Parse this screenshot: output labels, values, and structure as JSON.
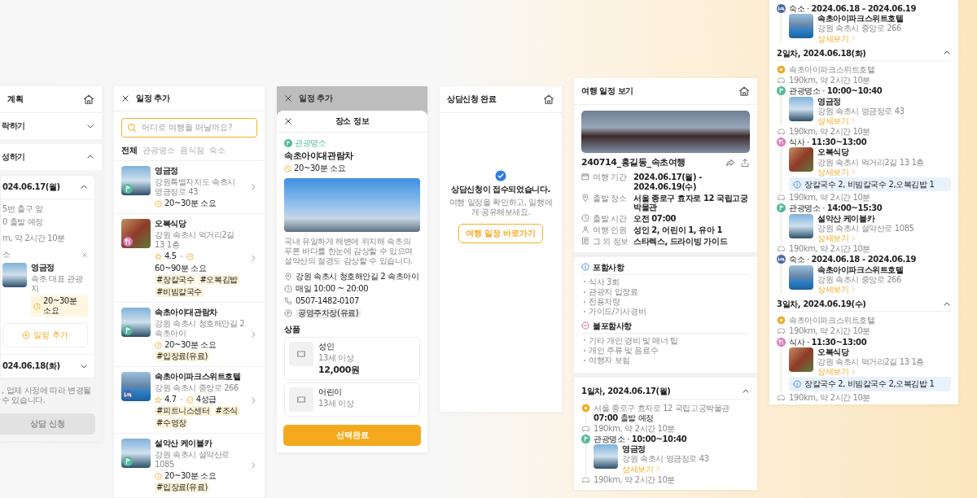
{
  "plan_screen": {
    "title": "계획",
    "sections": [
      {
        "label": "락하기",
        "expanded": false
      },
      {
        "label": "성하기",
        "expanded": true
      }
    ],
    "days": [
      {
        "label": "024.06.17(월)",
        "expanded": true,
        "start_lines": [
          "5번 출구 앞",
          "0 출발 예정"
        ],
        "drive": "m, 약 2시간 10분",
        "slot_label": "소",
        "place": {
          "name": "영금정",
          "description": "속초 대표 관광지",
          "duration": "20~30분 소요"
        },
        "add_label": "일정 추가"
      },
      {
        "label": "024.06.18(화)",
        "expanded": false
      }
    ],
    "note": ", 업체 사정에 따라 변경될 수 있습니다.",
    "submit": {
      "label": "상담 신청",
      "disabled": true
    }
  },
  "add_screen": {
    "title": "일정 추가",
    "search": {
      "placeholder": "어디로 여행을 떠날까요?"
    },
    "tabs": [
      {
        "label": "전체",
        "selected": true
      },
      {
        "label": "관광명소",
        "selected": false
      },
      {
        "label": "음식점",
        "selected": false
      },
      {
        "label": "숙소",
        "selected": false
      }
    ],
    "places": [
      {
        "kind": "attraction",
        "name": "영금정",
        "address": "강원특별자치도 속초시 영금정로 43",
        "meta": [
          {
            "kind": "time",
            "text": "20~30분 소요"
          }
        ]
      },
      {
        "kind": "food",
        "name": "오복식당",
        "address": "강원 속초시 먹거리2길 13 1층",
        "meta": [
          {
            "kind": "rating",
            "text": "4.5"
          },
          {
            "kind": "time",
            "text": "60~90분 소요"
          }
        ],
        "tags": [
          "#장칼국수",
          "#오복김밥",
          "#비빔칼국수"
        ]
      },
      {
        "kind": "attraction",
        "name": "속초아이대관람차",
        "address": "강원 속초시 청호해안길 2 속초아이",
        "meta": [
          {
            "kind": "time",
            "text": "20~30분 소요"
          }
        ],
        "tags": [
          "#입장료(유료)"
        ]
      },
      {
        "kind": "hotel",
        "name": "속초아이파크스위트호텔",
        "address": "강원 속초시 중앙로 266",
        "meta": [
          {
            "kind": "rating",
            "text": "4.7"
          },
          {
            "kind": "grade",
            "text": "4성급"
          }
        ],
        "tags": [
          "#피트니스센터",
          "#조식",
          "#수영장"
        ]
      },
      {
        "kind": "attraction",
        "name": "설악산 케이블카",
        "address": "강원 속초시 설악산로 1085",
        "meta": [
          {
            "kind": "time",
            "text": "20~30분 소요"
          }
        ],
        "tags": [
          "#입장료(유료)"
        ]
      }
    ]
  },
  "place_sheet": {
    "backdrop_title": "일정 추가",
    "title": "장소 정보",
    "category": {
      "kind": "attraction",
      "label": "관광명소"
    },
    "name": "속초아이대관람차",
    "duration": "20~30분 소요",
    "description": "국내 유일하게 해변에 위치해 속초의 푸른 바다를 한눈에 감상할 수 있으며 설악산의 절경도 감상할 수 있습니다.",
    "info": [
      {
        "kind": "address",
        "text": "강원 속초시 청호해안길 2 속초아이"
      },
      {
        "kind": "hours",
        "text": "매일 10:00 ~ 20:00"
      },
      {
        "kind": "phone",
        "text": "0507-1482-0107"
      },
      {
        "kind": "parking",
        "text": "공영주차장(유료)"
      }
    ],
    "products_title": "상품",
    "products": [
      {
        "name": "성인",
        "age": "13세 이상",
        "price": "12,000원"
      },
      {
        "name": "어린이",
        "age": "13세 이상"
      }
    ],
    "submit": "선택완료"
  },
  "done_screen": {
    "title": "상담신청 완료",
    "message": "상담신청이 접수되었습니다.",
    "sub": "여행 일정을 확인하고, 일행에게 공유해보세요.",
    "button": "여행 일정 바로가기"
  },
  "trip_screen": {
    "title": "여행 일정 보기",
    "trip_name": "240714_홍길동_속초여행",
    "info": [
      {
        "kind": "period",
        "label": "여행 기간",
        "value": "2024.06.17(월) - 2024.06.19(수)"
      },
      {
        "kind": "place",
        "label": "출발 장소",
        "value": "서울 종로구 효자로 12 국립고궁박물관"
      },
      {
        "kind": "time",
        "label": "출발 시간",
        "value": "오전 07:00"
      },
      {
        "kind": "people",
        "label": "여행 인원",
        "value": "성인 2, 어린이 1, 유아 1"
      },
      {
        "kind": "etc",
        "label": "그 외 정보",
        "value": "스타렉스, 드라이빙 가이드"
      }
    ],
    "inclusions": [
      {
        "kind": "included",
        "title": "포함사항",
        "items": [
          "식사 3회",
          "관광지 입장료",
          "전용차량",
          "가이드/기사경비"
        ]
      },
      {
        "kind": "excluded",
        "title": "불포함사항",
        "items": [
          "기타 개인 경비 및 매너 팁",
          "개인 주류 및 음료수",
          "여행자 보험"
        ]
      }
    ],
    "days": [
      {
        "label": "1일차, 2024.06.17(월)",
        "expanded": true,
        "entries": [
          {
            "kind": "start",
            "text": "서울 종로구 효자로 12 국립고궁박물관",
            "sub": "**07:00** 출발 예정"
          },
          {
            "kind": "drive",
            "text": "190km, 약 2시간 10분"
          },
          {
            "kind": "attraction",
            "header": "관광명소 · **10:00~10:40**",
            "name": "영금정",
            "address": "강원 속초시 영금정로 43",
            "link": "상세보기"
          },
          {
            "kind": "drive",
            "text": "190km, 약 2시간 10분"
          }
        ]
      }
    ]
  },
  "trip_screen_continued": {
    "entries": [
      {
        "kind": "hotel",
        "header": "숙소 · **2024.06.18 - 2024.06.19**",
        "name": "속초아이파크스위트호텔",
        "address": "강원 속초시 중앙로 266",
        "link": "상세보기"
      }
    ],
    "days": [
      {
        "label": "2일차, 2024.06.18(화)",
        "expanded": true,
        "entries": [
          {
            "kind": "start",
            "text": "속초아이파크스위트호텔"
          },
          {
            "kind": "drive",
            "text": "190km, 약 2시간 10분"
          },
          {
            "kind": "attraction",
            "header": "관광명소 · **10:00~10:40**",
            "name": "영금정",
            "address": "강원 속초시 영금정로 43",
            "link": "상세보기"
          },
          {
            "kind": "drive",
            "text": "190km, 약 2시간 10분"
          },
          {
            "kind": "food",
            "header": "식사 · **11:30~13:00**",
            "name": "오복식당",
            "address": "강원 속초시 먹거리2길 13 1층",
            "link": "상세보기",
            "note": "장칼국수 2, 비빔칼국수 2,오복김밥 1"
          },
          {
            "kind": "drive",
            "text": "190km, 약 2시간 10분"
          },
          {
            "kind": "attraction",
            "header": "관광명소 · **14:00~15:30**",
            "name": "설악산 케이블카",
            "address": "강원 속초시 설악산로 1085",
            "link": "상세보기"
          },
          {
            "kind": "drive",
            "text": "190km, 약 2시간 10분"
          },
          {
            "kind": "hotel",
            "header": "숙소 · **2024.06.18 - 2024.06.19**",
            "name": "속초아이파크스위트호텔",
            "address": "강원 속초시 중앙로 266",
            "link": "상세보기"
          }
        ]
      },
      {
        "label": "3일차, 2024.06.19(수)",
        "expanded": true,
        "entries": [
          {
            "kind": "start",
            "text": "속초아이파크스위트호텔"
          },
          {
            "kind": "drive",
            "text": "190km, 약 2시간 10분"
          },
          {
            "kind": "food",
            "header": "식사 · **11:30~13:00**",
            "name": "오복식당",
            "address": "강원 속초시 먹거리2길 13 1층",
            "link": "상세보기",
            "note": "장칼국수 2, 비빔칼국수 2,오복김밥 1"
          },
          {
            "kind": "drive",
            "text": "190km, 약 2시간 10분"
          }
        ]
      }
    ]
  }
}
